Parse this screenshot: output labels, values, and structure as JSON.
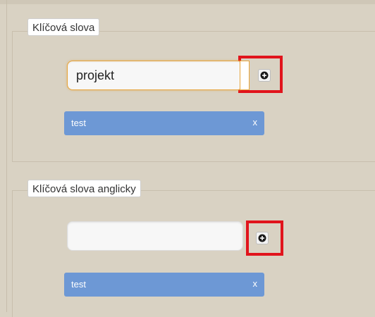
{
  "keywords_cz": {
    "legend": "Klíčová slova",
    "input_value": "projekt",
    "tags": [
      {
        "label": "test",
        "remove_label": "x"
      }
    ]
  },
  "keywords_en": {
    "legend": "Klíčová slova anglicky",
    "input_value": "",
    "tags": [
      {
        "label": "test",
        "remove_label": "x"
      }
    ]
  },
  "icons": {
    "add": "plus-circle-icon",
    "highlight_color": "#e1141c",
    "tag_color": "#6d98d5",
    "focus_color": "#e7a43b"
  }
}
